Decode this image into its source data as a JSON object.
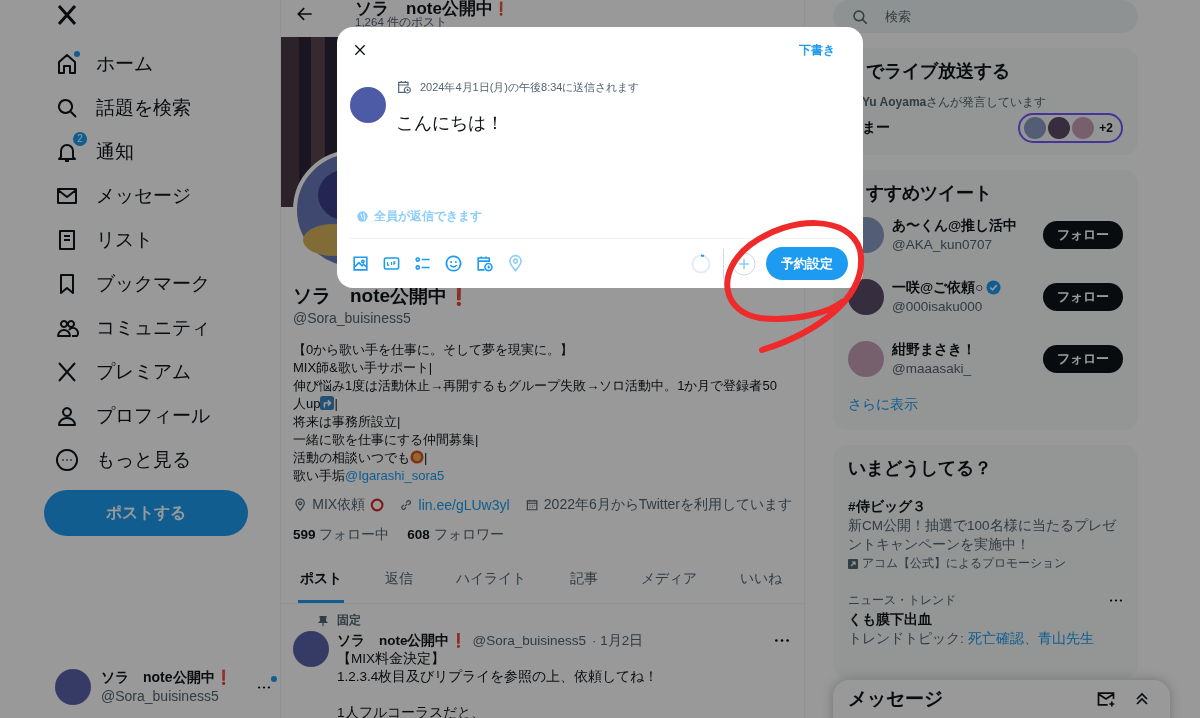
{
  "sidebar": {
    "items": [
      {
        "label": "ホーム",
        "dot": true
      },
      {
        "label": "話題を検索",
        "dot": false
      },
      {
        "label": "通知",
        "dot": false,
        "badge": "2"
      },
      {
        "label": "メッセージ",
        "dot": false
      },
      {
        "label": "リスト",
        "dot": false
      },
      {
        "label": "ブックマーク",
        "dot": false
      },
      {
        "label": "コミュニティ",
        "dot": false
      },
      {
        "label": "プレミアム",
        "dot": false
      },
      {
        "label": "プロフィール",
        "dot": false
      },
      {
        "label": "もっと見る",
        "dot": false
      }
    ],
    "post_button": "ポストする",
    "account": {
      "name": "ソラ　note公開中",
      "mark": "❗",
      "handle": "@Sora_buisiness5",
      "dot": true
    }
  },
  "profile": {
    "header": {
      "name": "ソラ　note公開中",
      "mark": "❗",
      "post_count": "1,264 件のポスト"
    },
    "name": "ソラ　note公開中",
    "mark": "❗",
    "handle": "@Sora_buisiness5",
    "bio": [
      {
        "kind": "text",
        "text": "【0から歌い手を仕事に。そして夢を現実に。】"
      },
      {
        "kind": "text",
        "text": "MIX師&歌い手サポート|"
      },
      {
        "kind": "text",
        "text": "伸び悩み1度は活動休止→再開するもグループ失敗→ソロ活動中。1か月で登録者50"
      },
      {
        "kind": "arrow_emoji",
        "text": "人up",
        "tail": "|"
      },
      {
        "kind": "text",
        "text": "将来は事務所設立|"
      },
      {
        "kind": "text",
        "text": "一緒に歌を仕事にする仲間募集|"
      },
      {
        "kind": "face_emoji",
        "text": "活動の相談いつでも",
        "tail": "|"
      },
      {
        "kind": "mention",
        "text": "歌い手垢",
        "link": "@Igarashi_sora5"
      }
    ],
    "location": "MIX依頼",
    "link": "lin.ee/gLUw3yl",
    "joined": "2022年6月からTwitterを利用しています",
    "following_count": "599",
    "following_label": "フォロー中",
    "followers_count": "608",
    "followers_label": "フォロワー"
  },
  "tabs": [
    {
      "label": "ポスト",
      "selected": true
    },
    {
      "label": "返信",
      "selected": false
    },
    {
      "label": "ハイライト",
      "selected": false
    },
    {
      "label": "記事",
      "selected": false
    },
    {
      "label": "メディア",
      "selected": false
    },
    {
      "label": "いいね",
      "selected": false
    }
  ],
  "pinned_post": {
    "pin_label": "固定",
    "name": "ソラ　note公開中",
    "mark": "❗",
    "handle": "@Sora_buisiness5",
    "date": "· 1月2日",
    "paragraphs": [
      "【MIX料金決定】\n1.2.3.4枚目及びリプライを参照の上、依頼してね！",
      "1人フルコーラスだと、"
    ]
  },
  "search": {
    "placeholder": "検索"
  },
  "spaces": {
    "title": "でライブ放送する",
    "host": "**Yu Aoyama**さんが発言しています",
    "name": "まー",
    "extra_count": "+2"
  },
  "recommend": {
    "title": "すすめツイート",
    "users": [
      {
        "name": "あ〜くん@推し活中",
        "handle": "@AKA_kun0707",
        "verified": false,
        "button": "フォロー"
      },
      {
        "name": "一咲@ご依頼○",
        "handle": "@000isaku000",
        "verified": true,
        "button": "フォロー"
      },
      {
        "name": "紺野まさき！",
        "handle": "@maaasaki_",
        "verified": false,
        "button": "フォロー"
      }
    ],
    "more": "さらに表示"
  },
  "trends": {
    "title": "いまどうしてる？",
    "items": [
      {
        "kind": "promoted",
        "title": "#侍ビッグ３",
        "text": "新CM公開！抽選で100名様に当たるプレゼントキャンペーンを実施中！",
        "promo": "アコム【公式】によるプロモーション"
      },
      {
        "kind": "trend",
        "category": "ニュース・トレンド",
        "title": "くも膜下出血",
        "topics_label": "トレンドトピック:",
        "topics": "死亡確認、青山先生"
      }
    ]
  },
  "messages_drawer": {
    "title": "メッセージ"
  },
  "compose": {
    "drafts": "下書き",
    "schedule_text": "2024年4月1日(月)の午後8:34に送信されます",
    "text": "こんにちは！",
    "reply_setting": "全員が返信できます",
    "submit": "予約設定"
  }
}
